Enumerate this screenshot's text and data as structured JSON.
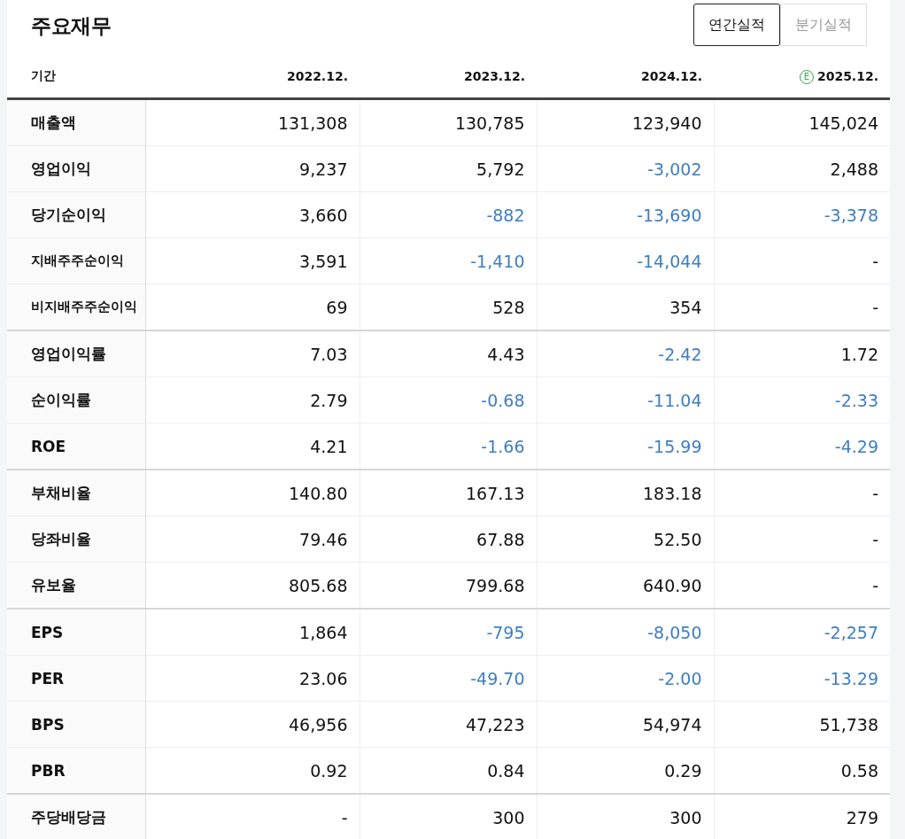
{
  "title": "주요재무",
  "tabs": [
    {
      "label": "연간실적",
      "selected": true
    },
    {
      "label": "분기실적",
      "selected": false
    }
  ],
  "columns": [
    {
      "label": "기간",
      "estimate": false
    },
    {
      "label": "2022.12.",
      "estimate": false
    },
    {
      "label": "2023.12.",
      "estimate": false
    },
    {
      "label": "2024.12.",
      "estimate": false
    },
    {
      "label": "2025.12.",
      "estimate": true
    }
  ],
  "estimate_badge": "E",
  "groups": [
    {
      "rows": [
        {
          "label": "매출액",
          "kind": "main",
          "cells": [
            "131,308",
            "130,785",
            "123,940",
            "145,024"
          ],
          "negative": [
            false,
            false,
            false,
            false
          ]
        },
        {
          "label": "영업이익",
          "kind": "main",
          "cells": [
            "9,237",
            "5,792",
            "-3,002",
            "2,488"
          ],
          "negative": [
            false,
            false,
            true,
            false
          ]
        },
        {
          "label": "당기순이익",
          "kind": "main",
          "cells": [
            "3,660",
            "-882",
            "-13,690",
            "-3,378"
          ],
          "negative": [
            false,
            true,
            true,
            true
          ]
        },
        {
          "label": "지배주주순이익",
          "kind": "sub",
          "cells": [
            "3,591",
            "-1,410",
            "-14,044",
            "-"
          ],
          "negative": [
            false,
            true,
            true,
            false
          ]
        },
        {
          "label": "비지배주주순이익",
          "kind": "sub",
          "cells": [
            "69",
            "528",
            "354",
            "-"
          ],
          "negative": [
            false,
            false,
            false,
            false
          ]
        }
      ]
    },
    {
      "rows": [
        {
          "label": "영업이익률",
          "kind": "main",
          "cells": [
            "7.03",
            "4.43",
            "-2.42",
            "1.72"
          ],
          "negative": [
            false,
            false,
            true,
            false
          ]
        },
        {
          "label": "순이익률",
          "kind": "main",
          "cells": [
            "2.79",
            "-0.68",
            "-11.04",
            "-2.33"
          ],
          "negative": [
            false,
            true,
            true,
            true
          ]
        },
        {
          "label": "ROE",
          "kind": "main",
          "cells": [
            "4.21",
            "-1.66",
            "-15.99",
            "-4.29"
          ],
          "negative": [
            false,
            true,
            true,
            true
          ]
        }
      ]
    },
    {
      "rows": [
        {
          "label": "부채비율",
          "kind": "main",
          "cells": [
            "140.80",
            "167.13",
            "183.18",
            "-"
          ],
          "negative": [
            false,
            false,
            false,
            false
          ]
        },
        {
          "label": "당좌비율",
          "kind": "main",
          "cells": [
            "79.46",
            "67.88",
            "52.50",
            "-"
          ],
          "negative": [
            false,
            false,
            false,
            false
          ]
        },
        {
          "label": "유보율",
          "kind": "main",
          "cells": [
            "805.68",
            "799.68",
            "640.90",
            "-"
          ],
          "negative": [
            false,
            false,
            false,
            false
          ]
        }
      ]
    },
    {
      "rows": [
        {
          "label": "EPS",
          "kind": "main",
          "cells": [
            "1,864",
            "-795",
            "-8,050",
            "-2,257"
          ],
          "negative": [
            false,
            true,
            true,
            true
          ]
        },
        {
          "label": "PER",
          "kind": "main",
          "cells": [
            "23.06",
            "-49.70",
            "-2.00",
            "-13.29"
          ],
          "negative": [
            false,
            true,
            true,
            true
          ]
        },
        {
          "label": "BPS",
          "kind": "main",
          "cells": [
            "46,956",
            "47,223",
            "54,974",
            "51,738"
          ],
          "negative": [
            false,
            false,
            false,
            false
          ]
        },
        {
          "label": "PBR",
          "kind": "main",
          "cells": [
            "0.92",
            "0.84",
            "0.29",
            "0.58"
          ],
          "negative": [
            false,
            false,
            false,
            false
          ]
        }
      ]
    },
    {
      "rows": [
        {
          "label": "주당배당금",
          "kind": "main",
          "cells": [
            "-",
            "300",
            "300",
            "279"
          ],
          "negative": [
            false,
            false,
            false,
            false
          ]
        }
      ]
    }
  ]
}
